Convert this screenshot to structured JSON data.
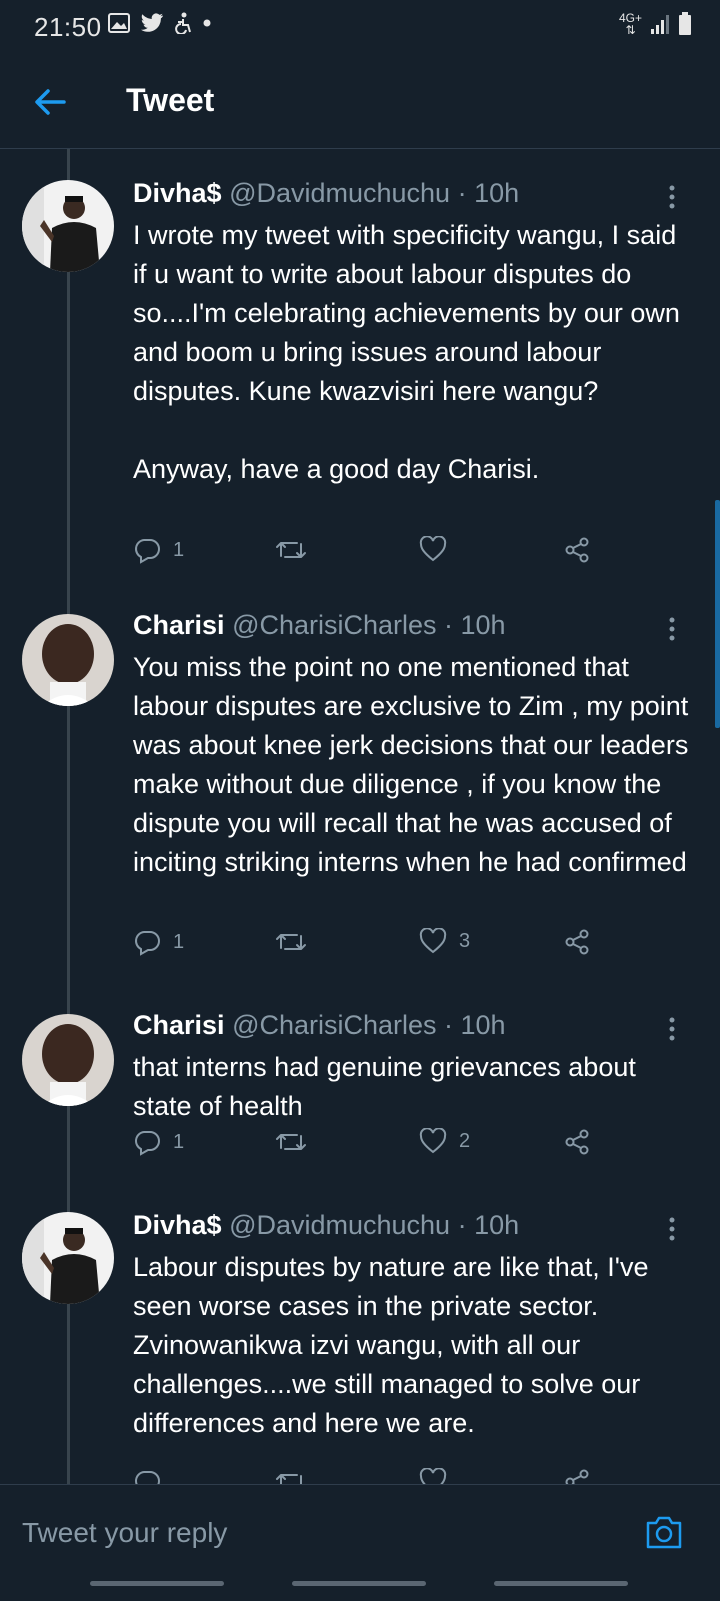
{
  "status": {
    "time": "21:50",
    "network": "4G+"
  },
  "header": {
    "title": "Tweet"
  },
  "tweets": [
    {
      "name": "Divha$",
      "handle": "@Davidmuchuchu · 10h",
      "text": "I wrote my tweet with specificity wangu, I said if u want to write about labour disputes do so....I'm celebrating achievements by our own and boom u bring issues around labour disputes. Kune kwazvisiri here wangu?\n\nAnyway, have a good day Charisi.",
      "replies": "1",
      "retweets": "",
      "likes": ""
    },
    {
      "name": "Charisi",
      "handle": "@CharisiCharles · 10h",
      "text": "You miss the point no one mentioned that labour disputes are exclusive to Zim , my point was about knee jerk decisions that our leaders make without due diligence , if you know the dispute you will recall that he was accused of inciting striking interns when he had confirmed",
      "replies": "1",
      "retweets": "",
      "likes": "3"
    },
    {
      "name": "Charisi",
      "handle": "@CharisiCharles · 10h",
      "text": "that interns had genuine grievances about state of health",
      "replies": "1",
      "retweets": "",
      "likes": "2"
    },
    {
      "name": "Divha$",
      "handle": "@Davidmuchuchu · 10h",
      "text": "Labour disputes by nature are like that, I've seen worse cases in the private sector. Zvinowanikwa izvi wangu, with all our challenges....we still managed to solve our differences and here we are.",
      "replies": "",
      "retweets": "",
      "likes": ""
    }
  ],
  "composer": {
    "placeholder": "Tweet your reply"
  },
  "colors": {
    "background": "#15202b",
    "accent": "#1d9bf0",
    "muted": "#8899a6"
  }
}
